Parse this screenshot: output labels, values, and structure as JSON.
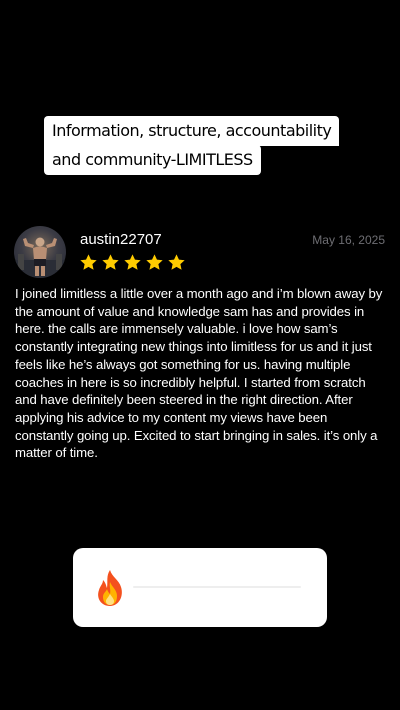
{
  "story": {
    "caption_lines": [
      "Information, structure, accountability",
      "and community-LIMITLESS"
    ]
  },
  "review": {
    "username": "austin22707",
    "date": "May 16, 2025",
    "rating": 5,
    "rating_max": 5,
    "star_color": "#FFCC00",
    "avatar_icon": "avatar-photo",
    "text": "I joined limitless a little over a month ago and i’m blown away by the amount of value and knowledge sam has and provides in here. the calls are immensely valuable. i love how sam’s constantly integrating new things into limitless for us and it just feels like he’s always got something for us. having multiple coaches in here is so incredibly helpful. I started from scratch and have definitely been steered in the right direction. After applying his advice to my content my views have been constantly going up. Excited to start bringing in sales. it’s only a matter of time."
  },
  "reply": {
    "emoji_icon": "fire-emoji-icon"
  },
  "colors": {
    "background": "#000000",
    "text": "#FFFFFF",
    "muted": "#6E6E73",
    "caption_bg": "#FFFFFF",
    "caption_text": "#000000"
  }
}
